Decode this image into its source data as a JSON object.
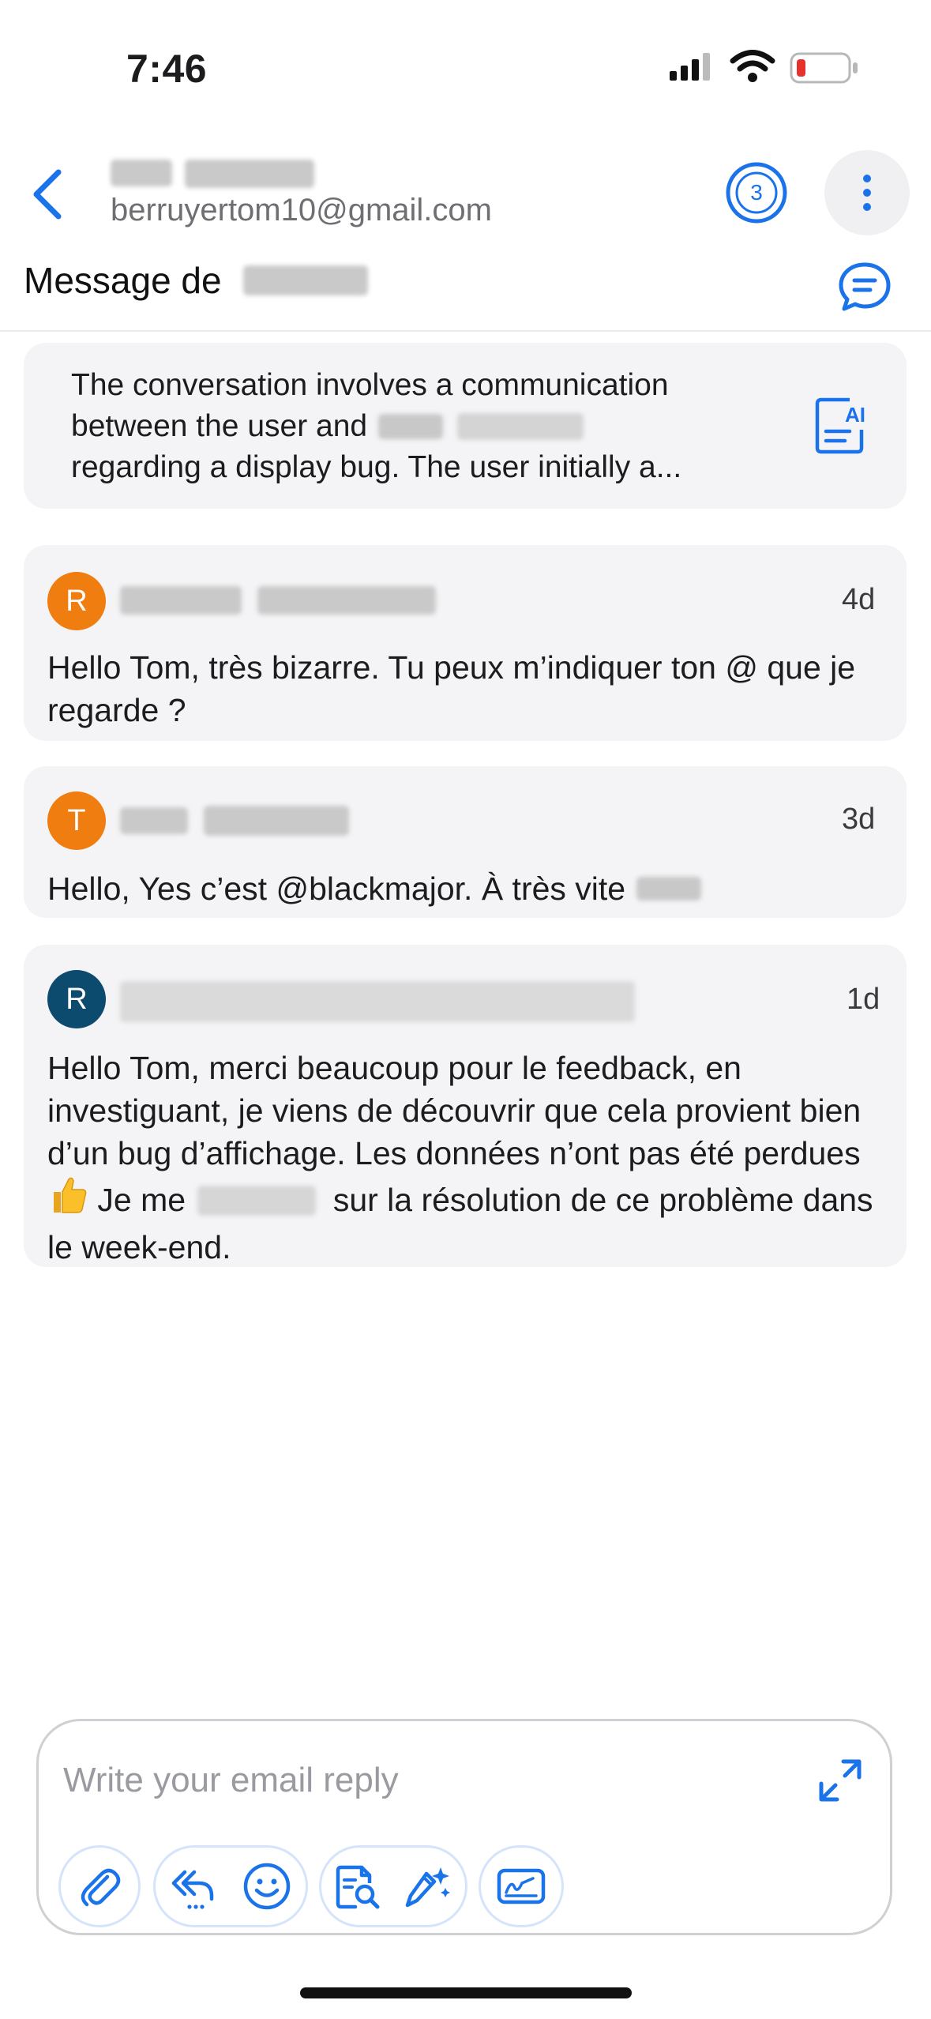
{
  "status_bar": {
    "time": "7:46"
  },
  "header": {
    "email": "berruyertom10@gmail.com",
    "thread_count": "3"
  },
  "subject": {
    "label": "Message de"
  },
  "summary": {
    "line1": "The conversation involves a communication",
    "line2": "between the user and",
    "line3": "regarding a display bug. The user initially a..."
  },
  "messages": [
    {
      "initial": "R",
      "avatar_color": "#ef7d0f",
      "time": "4d",
      "text": "Hello Tom, très bizarre. Tu peux m’indiquer ton @ que je regarde ?"
    },
    {
      "initial": "T",
      "avatar_color": "#ef7d0f",
      "time": "3d",
      "text": "Hello, Yes c’est @blackmajor. À très vite"
    },
    {
      "initial": "R",
      "avatar_color": "#0c4a6e",
      "time": "1d",
      "text_part1": "Hello Tom, merci beaucoup pour le feedback, en investiguant, je viens de découvrir que cela provient bien d’un bug d’affichage. Les données n’ont pas été perdues ",
      "text_part2": " Je me ",
      "text_part3": " sur la résolution de ce problème dans le week-end."
    }
  ],
  "reply": {
    "placeholder": "Write your email reply"
  },
  "colors": {
    "accent": "#1a73e8",
    "card": "#f4f4f6"
  }
}
